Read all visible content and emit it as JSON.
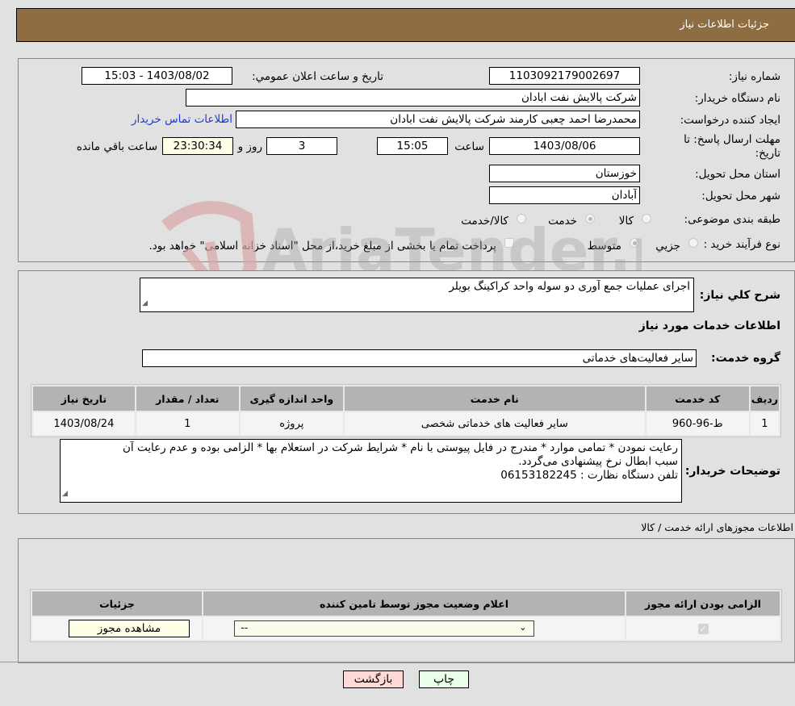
{
  "header": {
    "title": "جزئيات اطلاعات نياز"
  },
  "details": {
    "need_number_label": "شماره نياز:",
    "need_number": "1103092179002697",
    "announce_label": "تاريخ و ساعت اعلان عمومي:",
    "announce_value": "1403/08/02 - 15:03",
    "buyer_org_label": "نام دستگاه خريدار:",
    "buyer_org": "شرکت پالايش نفت ابادان",
    "creator_label": "ايجاد کننده درخواست:",
    "creator": "محمدرضا احمد چعبی کارمند شرکت پالایش نفت ابادان",
    "contact_link": "اطلاعات تماس خريدار",
    "deadline_label": "مهلت ارسال پاسخ: تا تاريخ:",
    "deadline_date": "1403/08/06",
    "time_label": "ساعت",
    "deadline_time": "15:05",
    "days_value": "3",
    "days_label": "روز و",
    "remaining_time": "23:30:34",
    "remaining_label": "ساعت باقي مانده",
    "province_label": "استان محل تحويل:",
    "province": "خوزستان",
    "city_label": "شهر محل تحويل:",
    "city": "آبادان",
    "category_label": "طبقه بندی موضوعی:",
    "category_options": [
      {
        "label": "کالا",
        "checked": false
      },
      {
        "label": "خدمت",
        "checked": true
      },
      {
        "label": "کالا/خدمت",
        "checked": false
      }
    ],
    "process_label": "نوع فرآيند خريد :",
    "process_options": [
      {
        "label": "جزيي",
        "checked": false
      },
      {
        "label": "متوسط",
        "checked": true
      }
    ],
    "treasury_note": "پرداخت تمام يا بخشی از مبلغ خريد،از محل \"اسناد خزانه اسلامی\" خواهد بود."
  },
  "description": {
    "label": "شرح كلي نياز:",
    "value": "اجرای عملیات جمع آوری دو سوله واحد کراکینگ بویلر"
  },
  "services": {
    "section_title": "اطلاعات خدمات مورد نياز",
    "group_label": "گروه خدمت:",
    "group_value": "سایر فعالیت‌های خدماتی",
    "columns": [
      "رديف",
      "كد خدمت",
      "نام خدمت",
      "واحد اندازه گيری",
      "تعداد / مقدار",
      "تاريخ نياز"
    ],
    "rows": [
      [
        "1",
        "ط-96-960",
        "سایر فعالیت های خدماتی شخصی",
        "پروژه",
        "1",
        "1403/08/24"
      ]
    ]
  },
  "buyer_notes": {
    "label": "توضيحات خريدار:",
    "lines": [
      "رعایت نمودن * تمامی موارد * مندرج در فایل پیوستی با نام * شرایط شرکت در استعلام بها * الزامی بوده و عدم رعایت آن",
      "سبب ابطال نرخ پیشنهادی می‌گردد.",
      "تلفن دستگاه نظارت : 06153182245"
    ]
  },
  "permits": {
    "section_title": "اطلاعات مجوزهای ارائه خدمت / کالا",
    "columns": [
      "الزامی بودن ارائه مجوز",
      "اعلام وضعيت مجوز توسط تامين کننده",
      "جزئيات"
    ],
    "row": {
      "required_checked": true,
      "status_value": "--",
      "details_button": "مشاهده مجوز"
    }
  },
  "footer": {
    "print_button": "چاپ",
    "back_button": "بازگشت"
  },
  "colors": {
    "header_bg": "#8f6d42",
    "print_bg": "#eaffea",
    "back_bg": "#ffd8d8",
    "link": "#1a3bd8"
  },
  "watermark": {
    "text": "AriaTender.neT"
  }
}
